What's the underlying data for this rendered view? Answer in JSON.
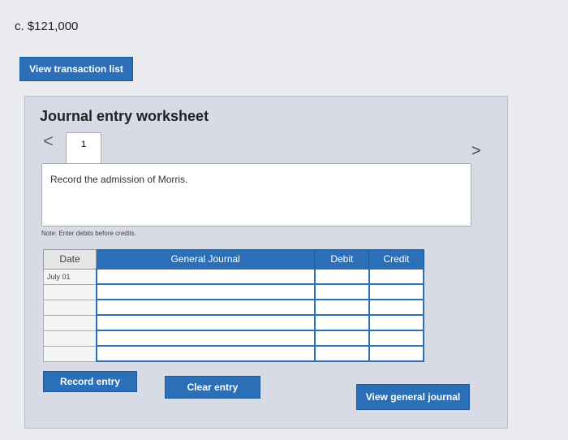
{
  "answer": {
    "text": "c. $121,000"
  },
  "buttons": {
    "view_transactions": "View transaction list",
    "record_entry": "Record entry",
    "clear_entry": "Clear entry",
    "view_general_journal": "View general journal"
  },
  "worksheet": {
    "title": "Journal entry worksheet",
    "prev_icon": "<",
    "next_icon": ">",
    "tab": "1",
    "task": "Record the admission of Morris.",
    "note": "Note: Enter debits before credits."
  },
  "table": {
    "headers": {
      "date": "Date",
      "journal": "General Journal",
      "debit": "Debit",
      "credit": "Credit"
    },
    "rows": [
      {
        "date": "July 01"
      },
      {
        "date": ""
      },
      {
        "date": ""
      },
      {
        "date": ""
      },
      {
        "date": ""
      },
      {
        "date": ""
      }
    ]
  }
}
